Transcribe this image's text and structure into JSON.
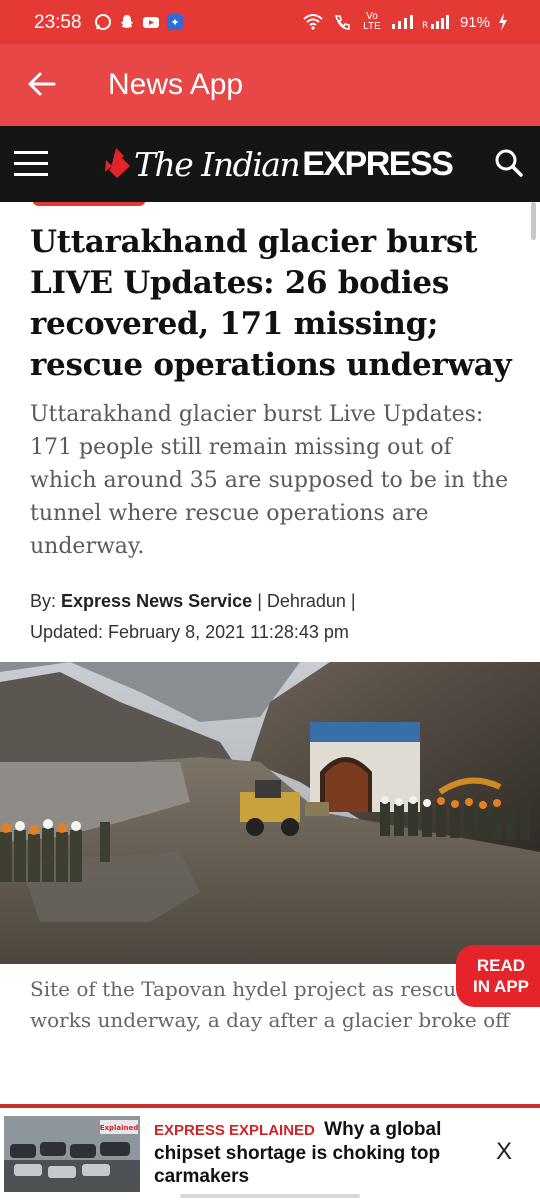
{
  "status_bar": {
    "time": "23:58",
    "network_label": "Vo LTE",
    "battery": "91%"
  },
  "app_bar": {
    "title": "News App"
  },
  "site_header": {
    "logo_the": "The Indian",
    "logo_express": "EXPRESS"
  },
  "article": {
    "headline": "Uttarakhand glacier burst LIVE Updates: 26 bodies recovered, 171 missing; rescue operations underway",
    "summary": "Uttarakhand glacier burst Live Updates: 171 people still remain missing out of which around 35 are supposed to be in the tunnel where rescue operations are underway.",
    "by_label": "By:",
    "author": "Express News Service",
    "location": "| Dehradun |",
    "updated": "Updated: February 8, 2021 11:28:43 pm",
    "caption": "Site of the Tapovan hydel project as rescue works underway, a day after a glacier broke off"
  },
  "read_in_app": {
    "line1": "READ",
    "line2": "IN APP"
  },
  "banner": {
    "kicker": "EXPRESS EXPLAINED",
    "title": "Why a global chipset shortage is choking top carmakers",
    "close": "X",
    "thumb_label": "Explained"
  },
  "colors": {
    "status_bar": "#e53935",
    "app_bar": "#e84747",
    "site_header": "#151515",
    "accent": "#e5232a"
  },
  "icons": {
    "back": "arrow-left-icon",
    "menu": "hamburger-menu-icon",
    "search": "search-icon"
  }
}
